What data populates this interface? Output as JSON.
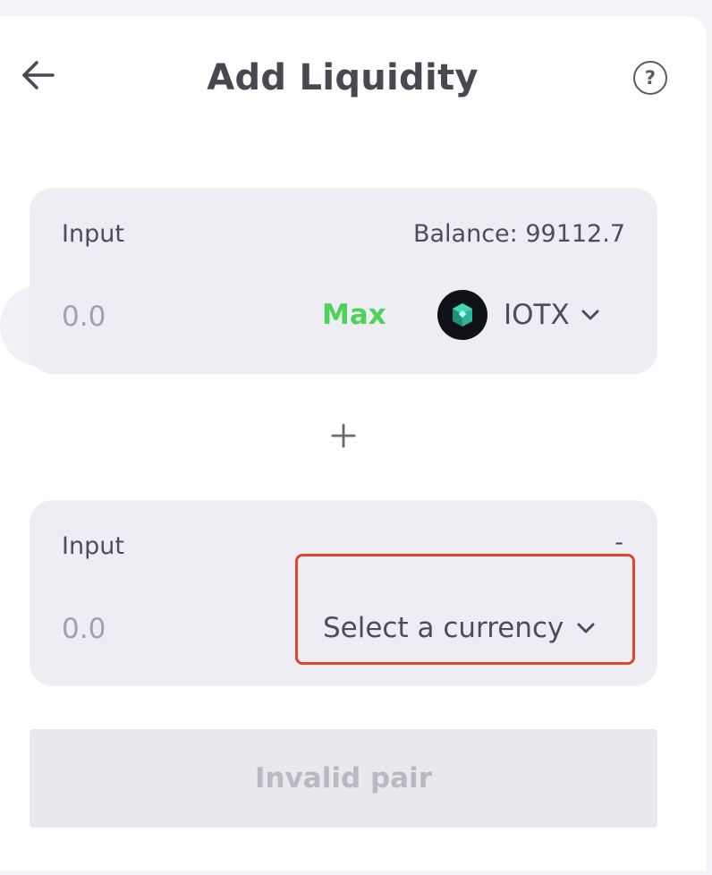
{
  "header": {
    "title": "Add Liquidity",
    "help_symbol": "?"
  },
  "input_a": {
    "label": "Input",
    "balance": "Balance: 99112.7",
    "amount_placeholder": "0.0",
    "max_label": "Max",
    "token_symbol": "IOTX",
    "token_icon": "iotx-logo-icon"
  },
  "plus_icon": "plus-icon",
  "input_b": {
    "label": "Input",
    "balance": "-",
    "amount_placeholder": "0.0",
    "select_label": "Select a currency"
  },
  "submit": {
    "label": "Invalid pair"
  },
  "colors": {
    "accent_green": "#4cd35a",
    "highlight_red": "#e2442f",
    "panel_bg": "#eeedf4"
  }
}
